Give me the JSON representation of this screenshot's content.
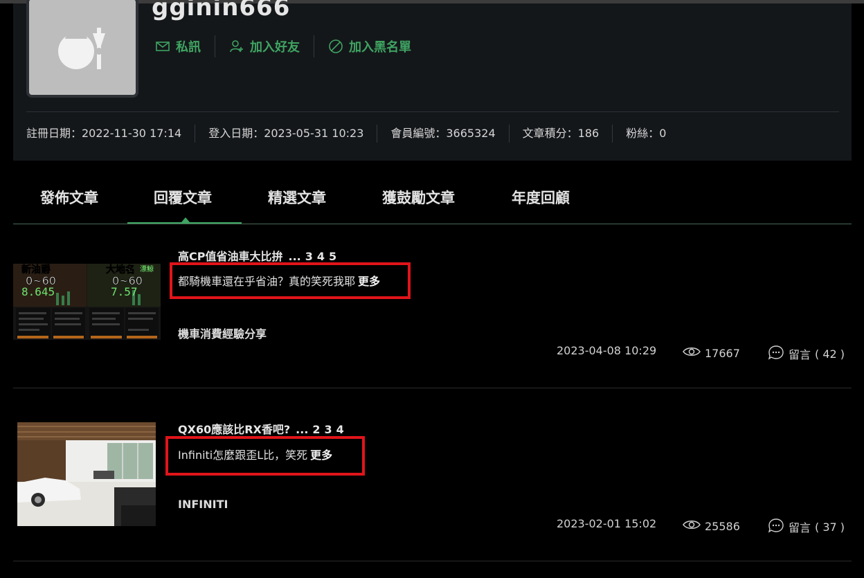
{
  "profile": {
    "username": "gginin666",
    "actions": [
      {
        "icon": "mail-icon",
        "label": "私訊"
      },
      {
        "icon": "add-friend-icon",
        "label": "加入好友"
      },
      {
        "icon": "block-icon",
        "label": "加入黑名單"
      }
    ],
    "stats": [
      "註冊日期：2022-11-30 17:14",
      "登入日期：2023-05-31 10:23",
      "會員編號：3665324",
      "文章積分：186",
      "粉絲：0"
    ]
  },
  "tabs": [
    {
      "label": "發佈文章"
    },
    {
      "label": "回覆文章",
      "active": true
    },
    {
      "label": "精選文章"
    },
    {
      "label": "獲鼓勵文章"
    },
    {
      "label": "年度回顧"
    }
  ],
  "posts": [
    {
      "title": "高CP值省油車大比拚",
      "ellipsis": "...",
      "pages": [
        "3",
        "4",
        "5"
      ],
      "thumb": {
        "label_left": "新油爵",
        "label_right": "大地名",
        "speed_left": "0~60",
        "speed_right": "0~60",
        "time_left": "8.645",
        "time_right": "7.57",
        "tag": "漂鯨"
      },
      "reply": "都騎機車還在乎省油？真的笑死我耶",
      "more": "更多",
      "board": "機車消費經驗分享",
      "date": "2023-04-08 10:29",
      "views": "17667",
      "comments_label": "留言",
      "comments": "( 42 )"
    },
    {
      "title": "QX60應該比RX香吧?",
      "ellipsis": "...",
      "pages": [
        "2",
        "3",
        "4"
      ],
      "reply": "Infiniti怎麼跟歪L比，笑死",
      "more": "更多",
      "board": "INFINITI",
      "date": "2023-02-01 15:02",
      "views": "25586",
      "comments_label": "留言",
      "comments": "( 37 )"
    }
  ],
  "colors": {
    "accent": "#3fa462",
    "highlight_box": "#e0141a",
    "card_bg": "#14171a",
    "page_bg": "#000000"
  }
}
